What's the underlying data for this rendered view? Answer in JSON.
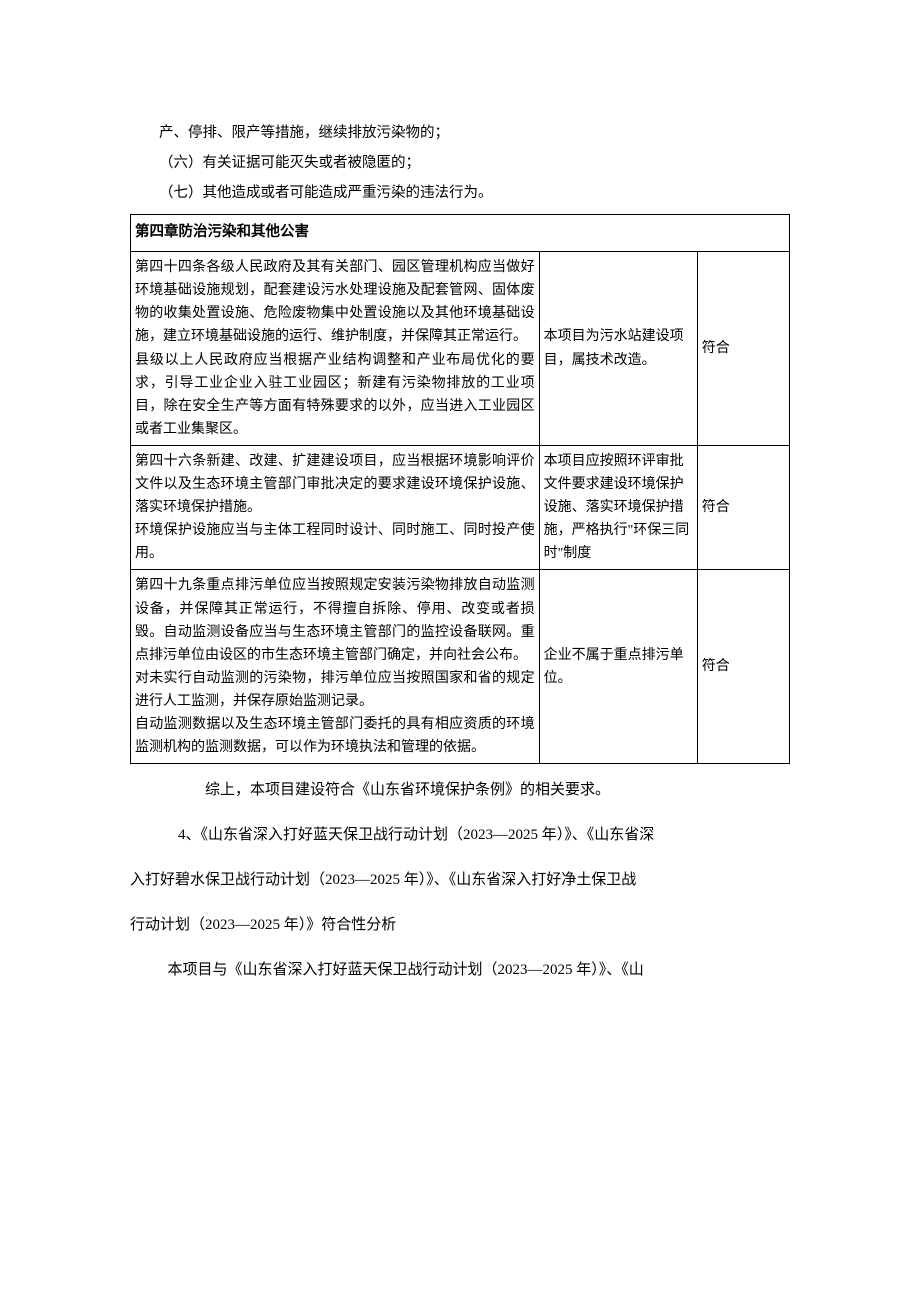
{
  "intro": {
    "line1": "产、停排、限产等措施，继续排放污染物的；",
    "line2": "（六）有关证据可能灭失或者被隐匿的；",
    "line3": "（七）其他造成或者可能造成严重污染的违法行为。"
  },
  "table": {
    "chapter_header": "第四章防治污染和其他公害",
    "rows": [
      {
        "col1": "第四十四条各级人民政府及其有关部门、园区管理机构应当做好环境基础设施规划，配套建设污水处理设施及配套管网、固体废物的收集处置设施、危险废物集中处置设施以及其他环境基础设施，建立环境基础设施的运行、维护制度，并保障其正常运行。\n县级以上人民政府应当根据产业结构调整和产业布局优化的要求，引导工业企业入驻工业园区；新建有污染物排放的工业项目，除在安全生产等方面有特殊要求的以外，应当进入工业园区或者工业集聚区。",
        "col2": "本项目为污水站建设项目，属技术改造。",
        "col3": "符合"
      },
      {
        "col1": "第四十六条新建、改建、扩建建设项目，应当根据环境影响评价文件以及生态环境主管部门审批决定的要求建设环境保护设施、落实环境保护措施。\n环境保护设施应当与主体工程同时设计、同时施工、同时投产使用。",
        "col2": "本项目应按照环评审批文件要求建设环境保护设施、落实环境保护措施，严格执行\"环保三同时\"制度",
        "col3": "符合"
      },
      {
        "col1": "第四十九条重点排污单位应当按照规定安装污染物排放自动监测设备，并保障其正常运行，不得擅自拆除、停用、改变或者损毁。自动监测设备应当与生态环境主管部门的监控设备联网。重点排污单位由设区的市生态环境主管部门确定，并向社会公布。\n对未实行自动监测的污染物，排污单位应当按照国家和省的规定进行人工监测，并保存原始监测记录。\n自动监测数据以及生态环境主管部门委托的具有相应资质的环境监测机构的监测数据，可以作为环境执法和管理的依据。",
        "col2": "企业不属于重点排污单位。",
        "col3": "符合"
      }
    ]
  },
  "after": {
    "summary": "综上，本项目建设符合《山东省环境保护条例》的相关要求。",
    "heading_line1": "4、《山东省深入打好蓝天保卫战行动计划（2023—2025 年）》、《山东省深",
    "heading_line2": "入打好碧水保卫战行动计划（2023—2025 年）》、《山东省深入打好净土保卫战",
    "heading_line3": "行动计划（2023—2025 年）》符合性分析",
    "body_line": "本项目与《山东省深入打好蓝天保卫战行动计划（2023—2025 年）》、《山"
  }
}
